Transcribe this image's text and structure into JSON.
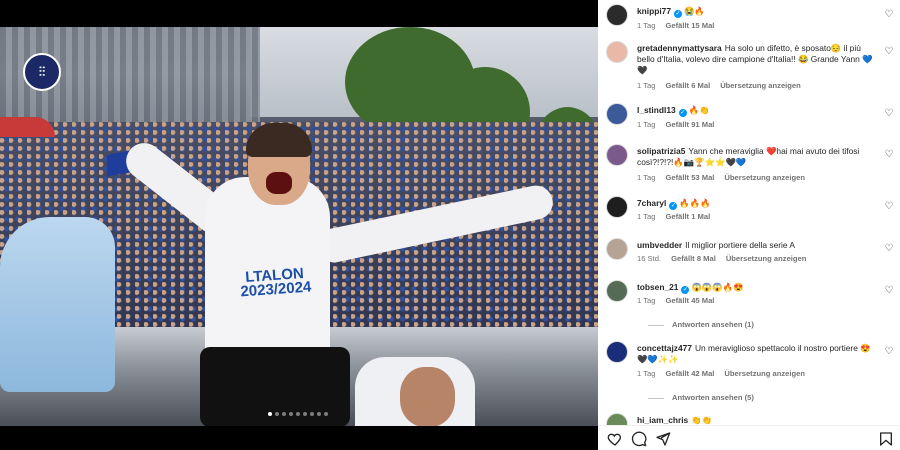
{
  "post": {
    "logo_text": "⫶⫶",
    "shirt_text": "LTALON\n2023/2024",
    "carousel": {
      "count": 9,
      "active_index": 0
    }
  },
  "comments": [
    {
      "user": "knippi77",
      "verified": true,
      "text": "😭🔥",
      "age": "1 Tag",
      "likes": "Gefällt 15 Mal",
      "translate": "",
      "replies": "",
      "avatar_color": "#2b2b2b"
    },
    {
      "user": "gretadennymattysara",
      "verified": false,
      "text": "Ha solo un difetto, è sposato😔 il più bello d'Italia, volevo dire campione d'Italia!! 😂 Grande Yann 💙🖤",
      "age": "1 Tag",
      "likes": "Gefällt 6 Mal",
      "translate": "Übersetzung anzeigen",
      "replies": "",
      "avatar_color": "#e9b8a6"
    },
    {
      "user": "l_stindl13",
      "verified": true,
      "text": "🔥👏",
      "age": "1 Tag",
      "likes": "Gefällt 91 Mal",
      "translate": "",
      "replies": "",
      "avatar_color": "#3a5a9a"
    },
    {
      "user": "solipatrizia5",
      "verified": false,
      "text": "Yann che meraviglia ❤️hai mai avuto dei tifosi così?!?!?!🔥📷🏆⭐⭐🖤💙",
      "age": "1 Tag",
      "likes": "Gefällt 53 Mal",
      "translate": "Übersetzung anzeigen",
      "replies": "",
      "avatar_color": "#7a5a8a"
    },
    {
      "user": "7charyl",
      "verified": true,
      "text": "🔥🔥🔥",
      "age": "1 Tag",
      "likes": "Gefällt 1 Mal",
      "translate": "",
      "replies": "",
      "avatar_color": "#1e1e1e"
    },
    {
      "user": "umbvedder",
      "verified": false,
      "text": "Il miglior portiere della serie A",
      "age": "16 Std.",
      "likes": "Gefällt 8 Mal",
      "translate": "Übersetzung anzeigen",
      "replies": "",
      "avatar_color": "#b7a394"
    },
    {
      "user": "tobsen_21",
      "verified": true,
      "text": "😱😱😱🔥😍",
      "age": "1 Tag",
      "likes": "Gefällt 45 Mal",
      "translate": "",
      "replies": "Antworten ansehen (1)",
      "avatar_color": "#556b55"
    },
    {
      "user": "concettajz477",
      "verified": false,
      "text": "Un meraviglioso spettacolo il nostro portiere 😍🖤💙✨✨",
      "age": "1 Tag",
      "likes": "Gefällt 42 Mal",
      "translate": "Übersetzung anzeigen",
      "replies": "Antworten ansehen (5)",
      "avatar_color": "#1a2d7a"
    },
    {
      "user": "hi_iam_chris",
      "verified": false,
      "text": "👏👏",
      "age": "",
      "likes": "",
      "translate": "",
      "replies": "",
      "avatar_color": "#6a8a5a"
    }
  ],
  "actions": {
    "like": "heart-outline-icon",
    "comment": "comment-icon",
    "share": "share-icon",
    "save": "bookmark-icon"
  }
}
